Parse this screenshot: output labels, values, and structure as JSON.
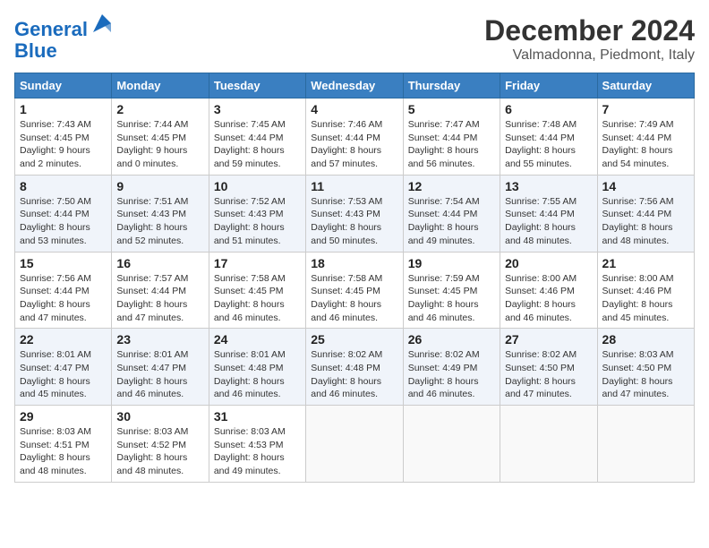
{
  "header": {
    "logo_line1": "General",
    "logo_line2": "Blue",
    "month_title": "December 2024",
    "subtitle": "Valmadonna, Piedmont, Italy"
  },
  "weekdays": [
    "Sunday",
    "Monday",
    "Tuesday",
    "Wednesday",
    "Thursday",
    "Friday",
    "Saturday"
  ],
  "weeks": [
    [
      {
        "day": "1",
        "sunrise": "Sunrise: 7:43 AM",
        "sunset": "Sunset: 4:45 PM",
        "daylight": "Daylight: 9 hours and 2 minutes."
      },
      {
        "day": "2",
        "sunrise": "Sunrise: 7:44 AM",
        "sunset": "Sunset: 4:45 PM",
        "daylight": "Daylight: 9 hours and 0 minutes."
      },
      {
        "day": "3",
        "sunrise": "Sunrise: 7:45 AM",
        "sunset": "Sunset: 4:44 PM",
        "daylight": "Daylight: 8 hours and 59 minutes."
      },
      {
        "day": "4",
        "sunrise": "Sunrise: 7:46 AM",
        "sunset": "Sunset: 4:44 PM",
        "daylight": "Daylight: 8 hours and 57 minutes."
      },
      {
        "day": "5",
        "sunrise": "Sunrise: 7:47 AM",
        "sunset": "Sunset: 4:44 PM",
        "daylight": "Daylight: 8 hours and 56 minutes."
      },
      {
        "day": "6",
        "sunrise": "Sunrise: 7:48 AM",
        "sunset": "Sunset: 4:44 PM",
        "daylight": "Daylight: 8 hours and 55 minutes."
      },
      {
        "day": "7",
        "sunrise": "Sunrise: 7:49 AM",
        "sunset": "Sunset: 4:44 PM",
        "daylight": "Daylight: 8 hours and 54 minutes."
      }
    ],
    [
      {
        "day": "8",
        "sunrise": "Sunrise: 7:50 AM",
        "sunset": "Sunset: 4:44 PM",
        "daylight": "Daylight: 8 hours and 53 minutes."
      },
      {
        "day": "9",
        "sunrise": "Sunrise: 7:51 AM",
        "sunset": "Sunset: 4:43 PM",
        "daylight": "Daylight: 8 hours and 52 minutes."
      },
      {
        "day": "10",
        "sunrise": "Sunrise: 7:52 AM",
        "sunset": "Sunset: 4:43 PM",
        "daylight": "Daylight: 8 hours and 51 minutes."
      },
      {
        "day": "11",
        "sunrise": "Sunrise: 7:53 AM",
        "sunset": "Sunset: 4:43 PM",
        "daylight": "Daylight: 8 hours and 50 minutes."
      },
      {
        "day": "12",
        "sunrise": "Sunrise: 7:54 AM",
        "sunset": "Sunset: 4:44 PM",
        "daylight": "Daylight: 8 hours and 49 minutes."
      },
      {
        "day": "13",
        "sunrise": "Sunrise: 7:55 AM",
        "sunset": "Sunset: 4:44 PM",
        "daylight": "Daylight: 8 hours and 48 minutes."
      },
      {
        "day": "14",
        "sunrise": "Sunrise: 7:56 AM",
        "sunset": "Sunset: 4:44 PM",
        "daylight": "Daylight: 8 hours and 48 minutes."
      }
    ],
    [
      {
        "day": "15",
        "sunrise": "Sunrise: 7:56 AM",
        "sunset": "Sunset: 4:44 PM",
        "daylight": "Daylight: 8 hours and 47 minutes."
      },
      {
        "day": "16",
        "sunrise": "Sunrise: 7:57 AM",
        "sunset": "Sunset: 4:44 PM",
        "daylight": "Daylight: 8 hours and 47 minutes."
      },
      {
        "day": "17",
        "sunrise": "Sunrise: 7:58 AM",
        "sunset": "Sunset: 4:45 PM",
        "daylight": "Daylight: 8 hours and 46 minutes."
      },
      {
        "day": "18",
        "sunrise": "Sunrise: 7:58 AM",
        "sunset": "Sunset: 4:45 PM",
        "daylight": "Daylight: 8 hours and 46 minutes."
      },
      {
        "day": "19",
        "sunrise": "Sunrise: 7:59 AM",
        "sunset": "Sunset: 4:45 PM",
        "daylight": "Daylight: 8 hours and 46 minutes."
      },
      {
        "day": "20",
        "sunrise": "Sunrise: 8:00 AM",
        "sunset": "Sunset: 4:46 PM",
        "daylight": "Daylight: 8 hours and 46 minutes."
      },
      {
        "day": "21",
        "sunrise": "Sunrise: 8:00 AM",
        "sunset": "Sunset: 4:46 PM",
        "daylight": "Daylight: 8 hours and 45 minutes."
      }
    ],
    [
      {
        "day": "22",
        "sunrise": "Sunrise: 8:01 AM",
        "sunset": "Sunset: 4:47 PM",
        "daylight": "Daylight: 8 hours and 45 minutes."
      },
      {
        "day": "23",
        "sunrise": "Sunrise: 8:01 AM",
        "sunset": "Sunset: 4:47 PM",
        "daylight": "Daylight: 8 hours and 46 minutes."
      },
      {
        "day": "24",
        "sunrise": "Sunrise: 8:01 AM",
        "sunset": "Sunset: 4:48 PM",
        "daylight": "Daylight: 8 hours and 46 minutes."
      },
      {
        "day": "25",
        "sunrise": "Sunrise: 8:02 AM",
        "sunset": "Sunset: 4:48 PM",
        "daylight": "Daylight: 8 hours and 46 minutes."
      },
      {
        "day": "26",
        "sunrise": "Sunrise: 8:02 AM",
        "sunset": "Sunset: 4:49 PM",
        "daylight": "Daylight: 8 hours and 46 minutes."
      },
      {
        "day": "27",
        "sunrise": "Sunrise: 8:02 AM",
        "sunset": "Sunset: 4:50 PM",
        "daylight": "Daylight: 8 hours and 47 minutes."
      },
      {
        "day": "28",
        "sunrise": "Sunrise: 8:03 AM",
        "sunset": "Sunset: 4:50 PM",
        "daylight": "Daylight: 8 hours and 47 minutes."
      }
    ],
    [
      {
        "day": "29",
        "sunrise": "Sunrise: 8:03 AM",
        "sunset": "Sunset: 4:51 PM",
        "daylight": "Daylight: 8 hours and 48 minutes."
      },
      {
        "day": "30",
        "sunrise": "Sunrise: 8:03 AM",
        "sunset": "Sunset: 4:52 PM",
        "daylight": "Daylight: 8 hours and 48 minutes."
      },
      {
        "day": "31",
        "sunrise": "Sunrise: 8:03 AM",
        "sunset": "Sunset: 4:53 PM",
        "daylight": "Daylight: 8 hours and 49 minutes."
      },
      null,
      null,
      null,
      null
    ]
  ]
}
